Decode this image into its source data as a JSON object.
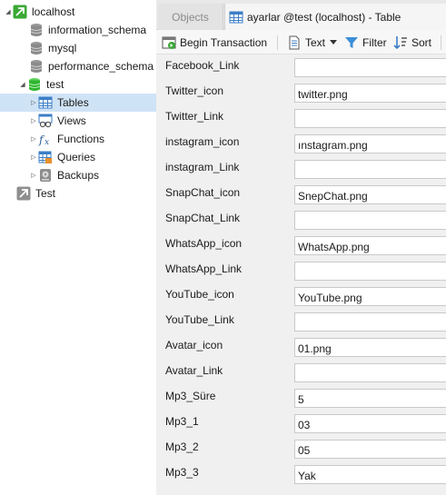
{
  "nav": {
    "items": [
      {
        "label": "localhost",
        "icon": "server-connection-icon",
        "toggle": "◢"
      },
      {
        "label": "information_schema",
        "icon": "database-icon",
        "toggle": ""
      },
      {
        "label": "mysql",
        "icon": "database-icon",
        "toggle": ""
      },
      {
        "label": "performance_schema",
        "icon": "database-icon",
        "toggle": ""
      },
      {
        "label": "test",
        "icon": "database-open-icon",
        "toggle": "◢"
      },
      {
        "label": "Tables",
        "icon": "table-icon",
        "toggle": "▷"
      },
      {
        "label": "Views",
        "icon": "view-icon",
        "toggle": "▷"
      },
      {
        "label": "Functions",
        "icon": "function-icon",
        "toggle": "▷"
      },
      {
        "label": "Queries",
        "icon": "query-icon",
        "toggle": "▷"
      },
      {
        "label": "Backups",
        "icon": "backup-icon",
        "toggle": "▷"
      },
      {
        "label": "Test",
        "icon": "server-connection-gray-icon",
        "toggle": ""
      }
    ],
    "selected": "Tables"
  },
  "tabs": {
    "objects": "Objects",
    "active": "ayarlar @test (localhost) - Table"
  },
  "toolbar": {
    "begin_transaction": "Begin Transaction",
    "text": "Text",
    "filter": "Filter",
    "sort": "Sort"
  },
  "form": {
    "fields": [
      {
        "label": "Facebook_Link",
        "value": ""
      },
      {
        "label": "Twitter_icon",
        "value": "twitter.png"
      },
      {
        "label": "Twitter_Link",
        "value": ""
      },
      {
        "label": "instagram_icon",
        "value": "ınstagram.png"
      },
      {
        "label": "instagram_Link",
        "value": ""
      },
      {
        "label": "SnapChat_icon",
        "value": "SnepChat.png"
      },
      {
        "label": "SnapChat_Link",
        "value": ""
      },
      {
        "label": "WhatsApp_icon",
        "value": "WhatsApp.png"
      },
      {
        "label": "WhatsApp_Link",
        "value": ""
      },
      {
        "label": "YouTube_icon",
        "value": "YouTube.png"
      },
      {
        "label": "YouTube_Link",
        "value": ""
      },
      {
        "label": "Avatar_icon",
        "value": "01.png"
      },
      {
        "label": "Avatar_Link",
        "value": ""
      },
      {
        "label": "Mp3_Süre",
        "value": "5"
      },
      {
        "label": "Mp3_1",
        "value": "03"
      },
      {
        "label": "Mp3_2",
        "value": "05"
      },
      {
        "label": "Mp3_3",
        "value": "Yak"
      }
    ]
  },
  "colors": {
    "selection": "#cfe3f6",
    "form_background": "#f0f0f0",
    "database_green": "#2fb52f",
    "connection_green": "#3aa935"
  }
}
